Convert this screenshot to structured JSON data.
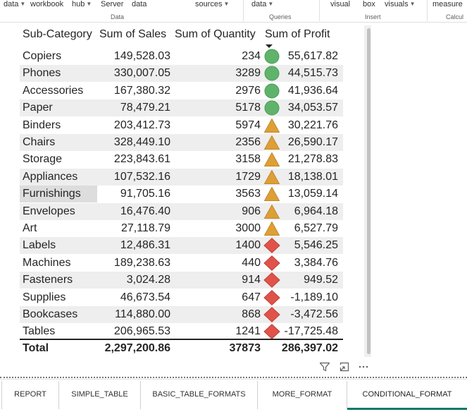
{
  "ribbon": {
    "items": [
      {
        "label": "data",
        "chev": true
      },
      {
        "label": "workbook",
        "chev": false
      },
      {
        "label": "hub",
        "chev": true
      },
      {
        "label": "Server",
        "chev": false
      },
      {
        "label": "data",
        "chev": false
      },
      {
        "label": "sources",
        "chev": true
      },
      {
        "label": "data",
        "chev": true
      },
      {
        "label": "visual",
        "chev": false
      },
      {
        "label": "box",
        "chev": false
      },
      {
        "label": "visuals",
        "chev": true
      },
      {
        "label": "measure",
        "chev": false
      }
    ],
    "groups": [
      "Data",
      "Queries",
      "Insert",
      "Calcul"
    ]
  },
  "table": {
    "headers": [
      "Sub-Category",
      "Sum of Sales",
      "Sum of Quantity",
      "Sum of Profit"
    ],
    "sorted_column": "Sum of Profit",
    "rows": [
      {
        "category": "Copiers",
        "sales": "149,528.03",
        "quantity": "234",
        "profit": "55,617.82",
        "icon": "circle"
      },
      {
        "category": "Phones",
        "sales": "330,007.05",
        "quantity": "3289",
        "profit": "44,515.73",
        "icon": "circle"
      },
      {
        "category": "Accessories",
        "sales": "167,380.32",
        "quantity": "2976",
        "profit": "41,936.64",
        "icon": "circle"
      },
      {
        "category": "Paper",
        "sales": "78,479.21",
        "quantity": "5178",
        "profit": "34,053.57",
        "icon": "circle"
      },
      {
        "category": "Binders",
        "sales": "203,412.73",
        "quantity": "5974",
        "profit": "30,221.76",
        "icon": "triangle"
      },
      {
        "category": "Chairs",
        "sales": "328,449.10",
        "quantity": "2356",
        "profit": "26,590.17",
        "icon": "triangle"
      },
      {
        "category": "Storage",
        "sales": "223,843.61",
        "quantity": "3158",
        "profit": "21,278.83",
        "icon": "triangle"
      },
      {
        "category": "Appliances",
        "sales": "107,532.16",
        "quantity": "1729",
        "profit": "18,138.01",
        "icon": "triangle"
      },
      {
        "category": "Furnishings",
        "sales": "91,705.16",
        "quantity": "3563",
        "profit": "13,059.14",
        "icon": "triangle"
      },
      {
        "category": "Envelopes",
        "sales": "16,476.40",
        "quantity": "906",
        "profit": "6,964.18",
        "icon": "triangle"
      },
      {
        "category": "Art",
        "sales": "27,118.79",
        "quantity": "3000",
        "profit": "6,527.79",
        "icon": "triangle"
      },
      {
        "category": "Labels",
        "sales": "12,486.31",
        "quantity": "1400",
        "profit": "5,546.25",
        "icon": "diamond"
      },
      {
        "category": "Machines",
        "sales": "189,238.63",
        "quantity": "440",
        "profit": "3,384.76",
        "icon": "diamond"
      },
      {
        "category": "Fasteners",
        "sales": "3,024.28",
        "quantity": "914",
        "profit": "949.52",
        "icon": "diamond"
      },
      {
        "category": "Supplies",
        "sales": "46,673.54",
        "quantity": "647",
        "profit": "-1,189.10",
        "icon": "diamond"
      },
      {
        "category": "Bookcases",
        "sales": "114,880.00",
        "quantity": "868",
        "profit": "-3,472.56",
        "icon": "diamond"
      },
      {
        "category": "Tables",
        "sales": "206,965.53",
        "quantity": "1241",
        "profit": "-17,725.48",
        "icon": "diamond"
      }
    ],
    "total": {
      "label": "Total",
      "sales": "2,297,200.86",
      "quantity": "37873",
      "profit": "286,397.02"
    },
    "selected_row": "Furnishings"
  },
  "visual_header_icons": [
    "filter-icon",
    "focus-mode-icon",
    "more-options-icon"
  ],
  "icon_colors": {
    "circle": "#5fb36b",
    "triangle": "#dd9f36",
    "diamond": "#e0534a"
  },
  "tabs": [
    "REPORT",
    "SIMPLE_TABLE",
    "BASIC_TABLE_FORMATS",
    "MORE_FORMAT",
    "CONDITIONAL_FORMAT"
  ],
  "active_tab": "CONDITIONAL_FORMAT",
  "accent": "#117865"
}
